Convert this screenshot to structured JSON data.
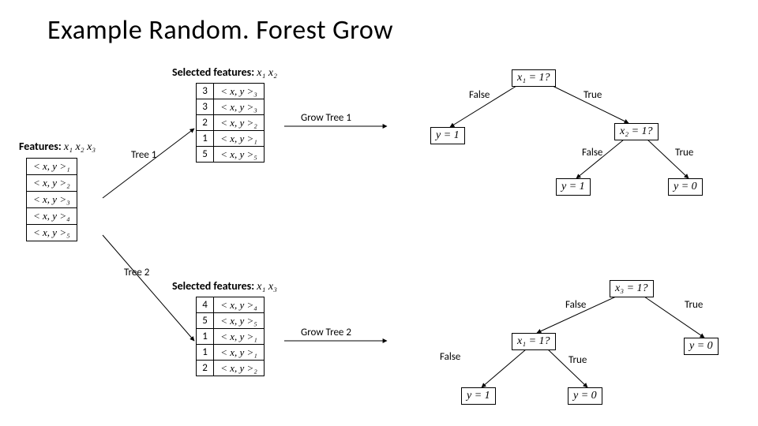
{
  "title": "Example Random. Forest Grow",
  "features_header": "Features:",
  "features_vars": "x₁ x₂ x₃",
  "feature_rows": [
    "< x, y >₁",
    "< x, y >₂",
    "< x, y >₃",
    "< x, y >₄",
    "< x, y >₅"
  ],
  "sel1_header": "Selected features:",
  "sel1_vars": "x₁ x₂",
  "sel1_rows": [
    {
      "n": "3",
      "xy": "< x, y >₃"
    },
    {
      "n": "3",
      "xy": "< x, y >₃"
    },
    {
      "n": "2",
      "xy": "< x, y >₂"
    },
    {
      "n": "1",
      "xy": "< x, y >₁"
    },
    {
      "n": "5",
      "xy": "< x, y >₅"
    }
  ],
  "sel2_header": "Selected features:",
  "sel2_vars": "x₁ x₃",
  "sel2_rows": [
    {
      "n": "4",
      "xy": "< x, y >₄"
    },
    {
      "n": "5",
      "xy": "< x, y >₅"
    },
    {
      "n": "1",
      "xy": "< x, y >₁"
    },
    {
      "n": "1",
      "xy": "< x, y >₁"
    },
    {
      "n": "2",
      "xy": "< x, y >₂"
    }
  ],
  "labels": {
    "tree1": "Tree 1",
    "tree2": "Tree 2",
    "grow1": "Grow Tree 1",
    "grow2": "Grow Tree 2",
    "false": "False",
    "true": "True"
  },
  "tree1": {
    "root": "x₁ = 1?",
    "left": "y = 1",
    "right": "x₂ = 1?",
    "rl": "y = 1",
    "rr": "y = 0"
  },
  "tree2": {
    "root": "x₃ = 1?",
    "right": "y = 0",
    "left": "x₁ = 1?",
    "ll": "y = 1",
    "lr": "y = 0"
  }
}
